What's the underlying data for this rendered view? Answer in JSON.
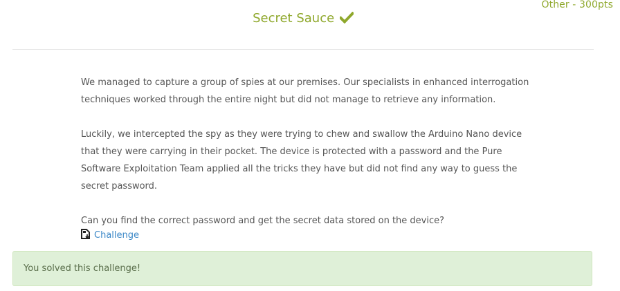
{
  "challenge": {
    "category": "Other - 300pts",
    "title": "Secret Sauce",
    "title_icon": "check-icon",
    "accent_color": "#8fa82c"
  },
  "description": {
    "paragraphs": [
      "We managed to capture a group of spies at our premises. Our specialists in enhanced interrogation techniques worked through the entire night but did not manage to retrieve any information.",
      "Luckily, we intercepted the spy as they were trying to chew and swallow the Arduino Nano device that they were carrying in their pocket. The device is protected with a password and the Pure Software Exploitation Team applied all the tricks they have but did not find any way to guess the secret password.",
      "Can you find the correct password and get the secret data stored on the device?"
    ]
  },
  "download": {
    "label": "Challenge",
    "icon": "file-download-icon",
    "link_color": "#3a87c7"
  },
  "status": {
    "message": "You solved this challenge!",
    "background": "#dff0d8"
  }
}
